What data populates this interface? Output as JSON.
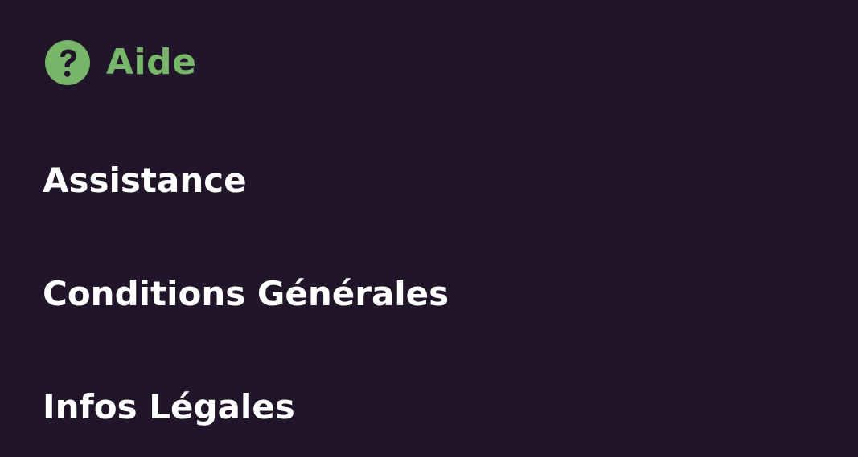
{
  "header": {
    "icon": "question-circle-icon",
    "title": "Aide",
    "accent_color": "#78b76a"
  },
  "menu": {
    "items": [
      {
        "label": "Assistance"
      },
      {
        "label": "Conditions Générales"
      },
      {
        "label": "Infos Légales"
      }
    ]
  },
  "colors": {
    "background": "#21152a",
    "text": "#ffffff"
  }
}
